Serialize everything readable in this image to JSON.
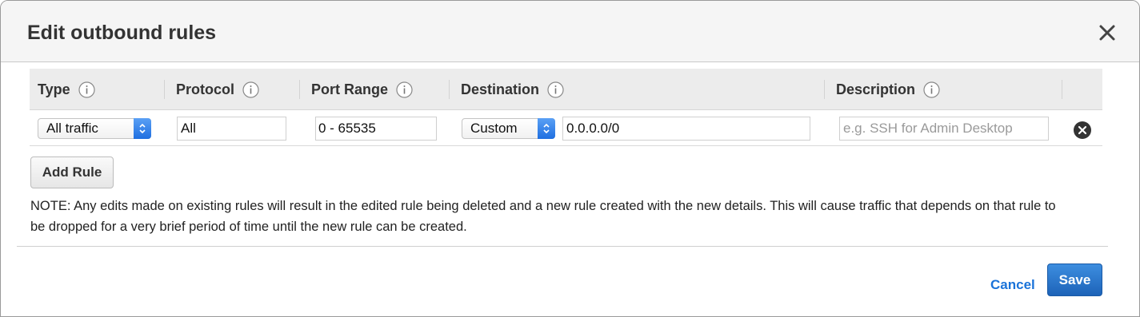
{
  "dialog": {
    "title": "Edit outbound rules",
    "close_icon": "close-icon"
  },
  "table": {
    "headers": [
      {
        "label": "Type",
        "icon": "info-icon"
      },
      {
        "label": "Protocol",
        "icon": "info-icon"
      },
      {
        "label": "Port Range",
        "icon": "info-icon"
      },
      {
        "label": "Destination",
        "icon": "info-icon"
      },
      {
        "label": "Description",
        "icon": "info-icon"
      }
    ],
    "rows": [
      {
        "type": "All traffic",
        "protocol": "All",
        "port_range": "0 - 65535",
        "destination_type": "Custom",
        "destination_value": "0.0.0.0/0",
        "description_placeholder": "e.g. SSH for Admin Desktop",
        "description_value": "",
        "remove_icon": "remove-icon"
      }
    ]
  },
  "actions": {
    "add_rule_label": "Add Rule",
    "cancel_label": "Cancel",
    "save_label": "Save"
  },
  "note": "NOTE: Any edits made on existing rules will result in the edited rule being deleted and a new rule created with the new details. This will cause traffic that depends on that rule to be dropped for a very brief period of time until the new rule can be created.",
  "colors": {
    "accent": "#1a73d9",
    "save_button": "#2b78cf",
    "select_arrow": "#1f6fe0"
  }
}
